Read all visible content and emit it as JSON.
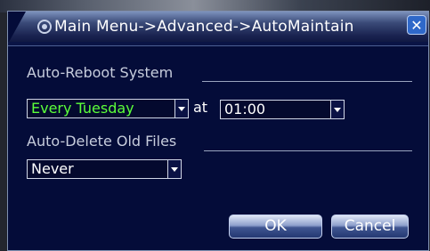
{
  "window": {
    "title": "Main Menu->Advanced->AutoMaintain",
    "close_glyph": "✕"
  },
  "auto_reboot": {
    "section_label": "Auto-Reboot System",
    "frequency_value": "Every Tuesday",
    "at_label": "at",
    "time_value": "01:00",
    "frequency_color": "#5cff3a"
  },
  "auto_delete": {
    "section_label": "Auto-Delete Old Files",
    "value": "Never"
  },
  "buttons": {
    "ok_label": "OK",
    "cancel_label": "Cancel"
  },
  "icons": {
    "title": "menu-icon",
    "close": "close-icon",
    "dropdown": "chevron-down-icon"
  }
}
